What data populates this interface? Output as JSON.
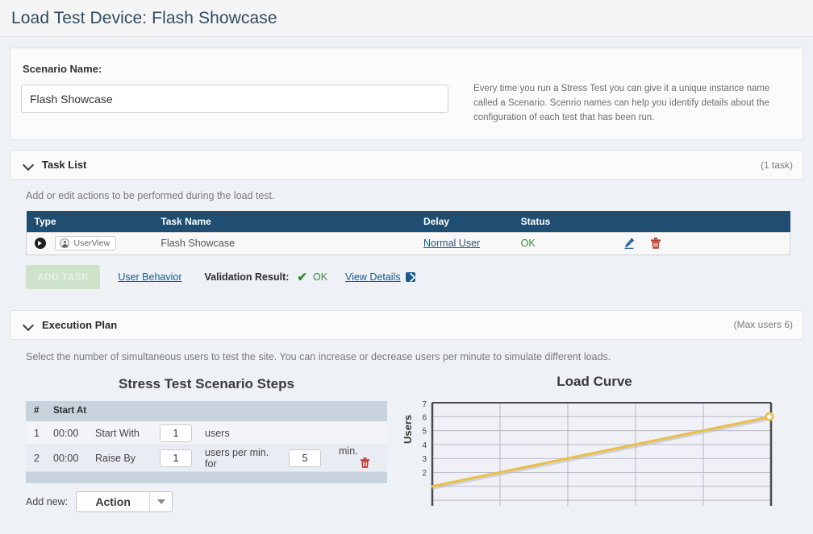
{
  "header": {
    "title": "Load Test Device: Flash Showcase"
  },
  "scenario": {
    "label": "Scenario Name:",
    "value": "Flash Showcase",
    "placeholder": "Scenario Name",
    "help": "Every time you run a Stress Test you can give it a unique instance name called a Scenario. Scenrio names can help you identify details about the configuration of each test that has been run."
  },
  "task_list": {
    "title": "Task List",
    "meta": "(1 task)",
    "description": "Add or edit actions to be performed during the load test.",
    "columns": [
      "Type",
      "Task Name",
      "Delay",
      "Status",
      ""
    ],
    "rows": [
      {
        "type_badge": "UserView",
        "name": "Flash Showcase",
        "delay": "Normal User",
        "status": "OK"
      }
    ],
    "add_task_label": "ADD TASK",
    "user_behavior_label": "User Behavior",
    "validation_label": "Validation Result:",
    "validation_check": "✔",
    "validation_status": "OK",
    "view_details_label": "View Details"
  },
  "execution_plan": {
    "title": "Execution Plan",
    "meta": "(Max users 6)",
    "description": "Select the number of simultaneous users to test the site. You can increase or decrease users per minute to simulate different loads.",
    "steps_title": "Stress Test Scenario Steps",
    "steps_columns": [
      "#",
      "Start At",
      "",
      "",
      "",
      "",
      ""
    ],
    "steps": [
      {
        "num": "1",
        "start_at": "00:00",
        "action": "Start With",
        "value1": "1",
        "unit1": "users",
        "value2": "",
        "unit2": "",
        "deletable": false
      },
      {
        "num": "2",
        "start_at": "00:00",
        "action": "Raise By",
        "value1": "1",
        "unit1": "users per min. for",
        "value2": "5",
        "unit2": "min.",
        "deletable": true
      }
    ],
    "add_new_label": "Add new:",
    "add_new_value": "Action",
    "add_new_options": [
      "Action"
    ]
  },
  "chart_data": {
    "type": "line",
    "title": "Load Curve",
    "xlabel": "",
    "ylabel": "Users",
    "ylim": [
      0,
      7
    ],
    "yticks": [
      0,
      1,
      2,
      3,
      4,
      5,
      6,
      7
    ],
    "visible_yticks": [
      2,
      3,
      4,
      5,
      6,
      7
    ],
    "xlim": [
      0,
      5
    ],
    "xticks": [
      0,
      1,
      2,
      3,
      4,
      5
    ],
    "grid": true,
    "legend": "none",
    "series": [
      {
        "name": "Users",
        "color": "#e8c04a",
        "x": [
          0,
          5
        ],
        "values": [
          1,
          6
        ],
        "marker_end": {
          "x": 5,
          "y": 6
        }
      }
    ]
  }
}
